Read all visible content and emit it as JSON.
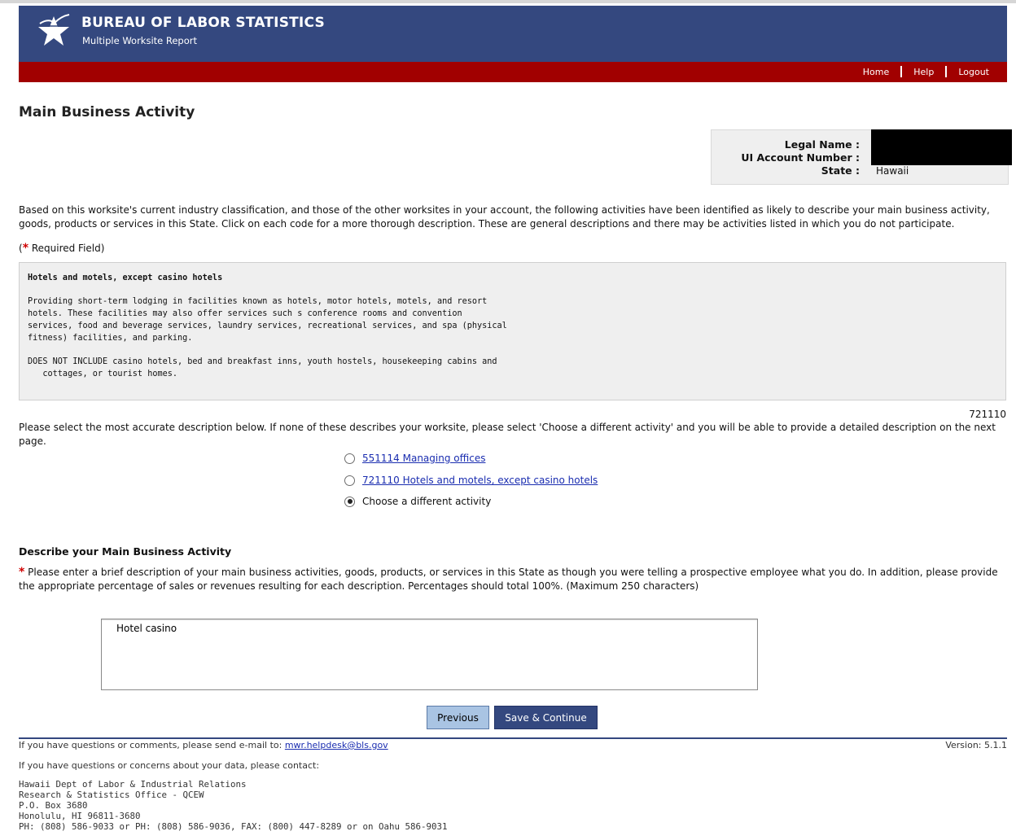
{
  "header": {
    "org_name": "BUREAU OF LABOR STATISTICS",
    "app_name": "Multiple Worksite Report",
    "links": [
      "Home",
      "Help",
      "Logout"
    ]
  },
  "page_title": "Main Business Activity",
  "account": {
    "legal_name_label": "Legal Name :",
    "ui_account_label": "UI Account Number :",
    "state_label": "State :",
    "state_value": "Hawaii"
  },
  "intro_text": "Based on this worksite's current industry classification, and those of the other worksites in your account, the following activities have been identified as likely to describe your main business activity, goods, products or services in this State. Click on each code for a more thorough description. These are general descriptions and there may be activities listed in which you do not participate.",
  "required_note": {
    "open": "(",
    "star": "*",
    "text": " Required Field)"
  },
  "description_box": {
    "title": "Hotels and motels, except casino hotels",
    "body": "Providing short-term lodging in facilities known as hotels, motor hotels, motels, and resort\nhotels. These facilities may also offer services such s conference rooms and convention\nservices, food and beverage services, laundry services, recreational services, and spa (physical\nfitness) facilities, and parking.",
    "excludes": "DOES NOT INCLUDE casino hotels, bed and breakfast inns, youth hostels, housekeeping cabins and\n   cottages, or tourist homes."
  },
  "code_value": "721110",
  "select_instruction": "Please select the most accurate description below. If none of these describes your worksite, please select 'Choose a different activity' and you will be able to provide a detailed description on the next page.",
  "options": [
    {
      "label": "551114 Managing offices",
      "selected": false,
      "link": true
    },
    {
      "label": "721110 Hotels and motels, except casino hotels",
      "selected": false,
      "link": true
    },
    {
      "label": "Choose a different activity",
      "selected": true,
      "link": false
    }
  ],
  "describe_section": {
    "heading": "Describe your Main Business Activity",
    "star": "*",
    "instructions": " Please enter a brief description of your main business activities, goods, products, or services in this State as though you were telling a prospective employee what you do. In addition, please provide the appropriate percentage of sales or revenues resulting for each description. Percentages should total 100%. (Maximum 250 characters)",
    "textarea_value": "Hotel casino"
  },
  "buttons": {
    "previous": "Previous",
    "save": "Save & Continue"
  },
  "footer": {
    "email_prefix": "If you have questions or comments, please send e-mail to: ",
    "email": "mwr.helpdesk@bls.gov",
    "version": "Version: 5.1.1",
    "contact_intro": "If you have questions or concerns about your data, please contact:",
    "contact_lines": "Hawaii Dept of Labor & Industrial Relations\nResearch & Statistics Office - QCEW\nP.O. Box 3680\nHonolulu, HI 96811-3680\nPH: (808) 586-9033 or PH: (808) 586-9036, FAX: (800) 447-8289 or on Oahu 586-9031"
  },
  "colors": {
    "banner": "#34487f",
    "redbar": "#a10000",
    "required": "#d00000",
    "link": "#1a2db0"
  }
}
